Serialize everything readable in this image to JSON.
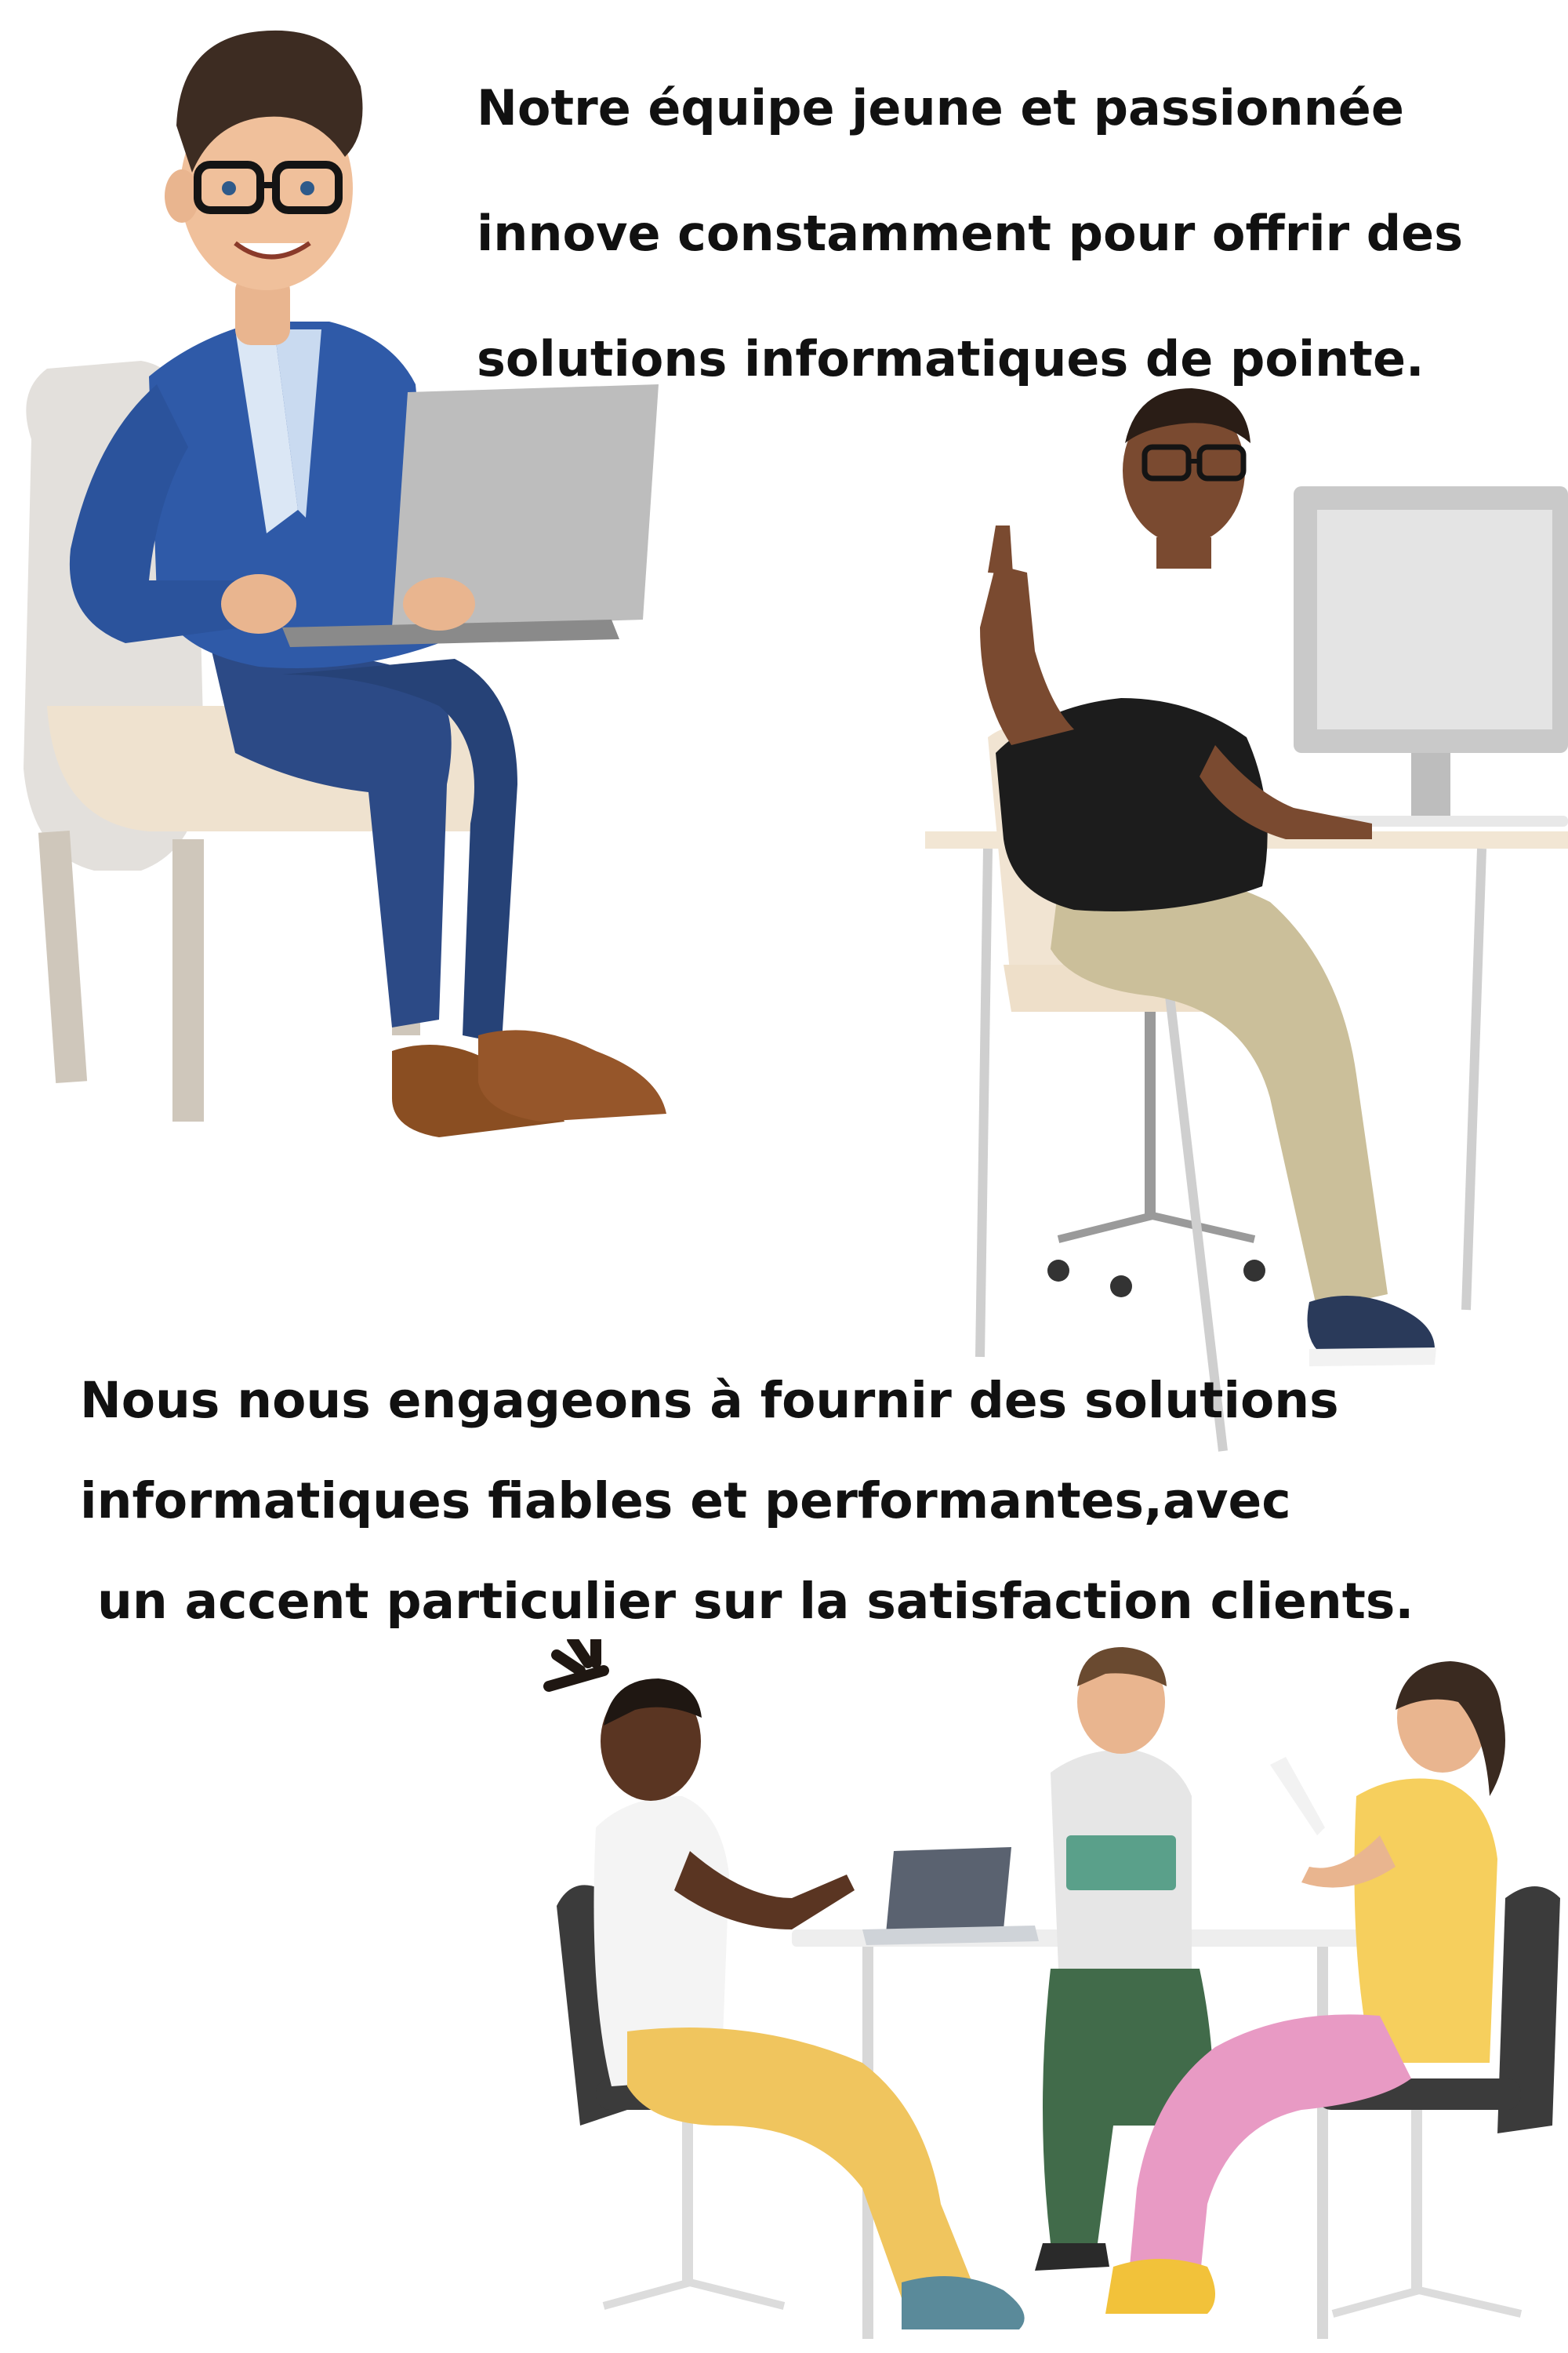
{
  "block_1": {
    "lines": [
      "Notre équipe jeune et passionnée",
      "innove constamment pour offrir des",
      "solutions informatiques de pointe."
    ]
  },
  "block_2": {
    "lines": [
      "Nous nous engageons à fournir des solutions",
      "informatiques fiables et performantes,avec",
      "un accent particulier sur la satisfaction clients."
    ]
  },
  "colors": {
    "text": "#111111",
    "background": "#ffffff",
    "blazer": "#2f5aa8",
    "trousers": "#2c4a86",
    "shoes": "#8a4e22",
    "armchair": "#e9e6e1",
    "desk": "#f2e6d4",
    "monitor": "#c9c9c9",
    "khaki": "#cbbf9a",
    "yellow_shirt": "#f6cf5d",
    "pink_pants": "#e89ac4",
    "green_pants": "#416b4a",
    "mustard_pants": "#f0c55e"
  },
  "icons": {
    "scene_1": "man-with-laptop-in-armchair-illustration",
    "scene_2": "man-at-desktop-computer-illustration",
    "scene_3": "team-meeting-at-table-illustration"
  }
}
